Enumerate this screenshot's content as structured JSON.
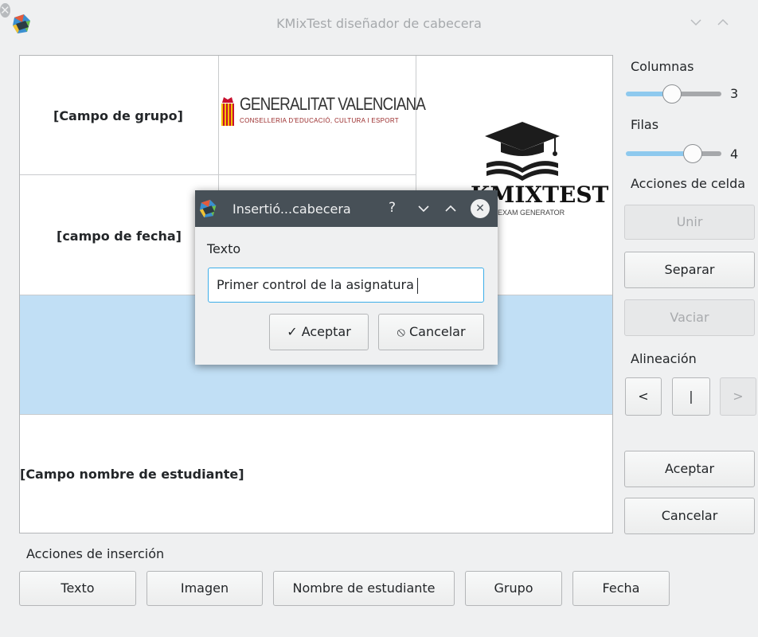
{
  "window": {
    "title": "KMixTest diseñador de cabecera",
    "min_icon": "chevron-down",
    "max_icon": "chevron-up",
    "close_icon": "close"
  },
  "grid": {
    "group_field": "[Campo de grupo]",
    "date_field": "[campo de fecha]",
    "student_field": "[Campo nombre de estudiante]",
    "logo_gv": {
      "main": "GENERALITAT VALENCIANA",
      "sub": "CONSELLERIA D'EDUCACIÓ, CULTURA I ESPORT"
    },
    "logo_kmixtest": {
      "main": "KMIXTEST",
      "sub": "EXAM GENERATOR"
    }
  },
  "panel": {
    "columns_label": "Columnas",
    "columns_value": "3",
    "rows_label": "Filas",
    "rows_value": "4",
    "cell_actions_label": "Acciones de celda",
    "merge": "Unir",
    "split": "Separar",
    "clear": "Vaciar",
    "alignment_label": "Alineación",
    "align_left": "<",
    "align_center": "|",
    "align_right": ">",
    "accept": "Aceptar",
    "cancel": "Cancelar"
  },
  "insert": {
    "label": "Acciones de inserción",
    "text": "Texto",
    "image": "Imagen",
    "student_name": "Nombre de estudiante",
    "group": "Grupo",
    "date": "Fecha"
  },
  "dialog": {
    "title": "Insertió...cabecera",
    "help": "?",
    "field_label": "Texto",
    "input_value": "Primer control de la asignatura",
    "accept": "Aceptar",
    "cancel": "Cancelar"
  },
  "colors": {
    "accent": "#3daee9",
    "selection": "#c1dff5",
    "dialog_titlebar": "#475057"
  }
}
